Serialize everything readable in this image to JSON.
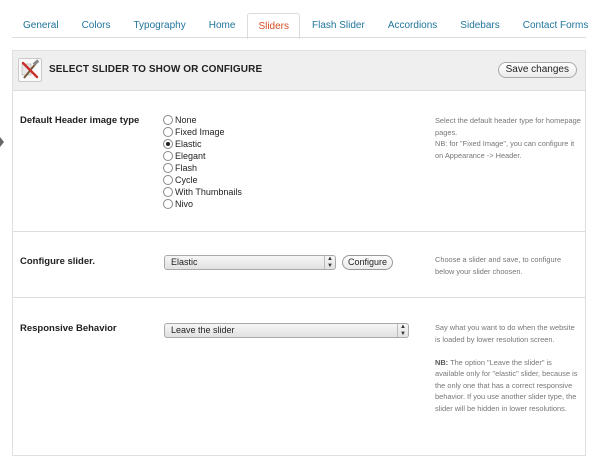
{
  "tabs": [
    "General",
    "Colors",
    "Typography",
    "Home",
    "Sliders",
    "Flash Slider",
    "Accordions",
    "Sidebars",
    "Contact Forms"
  ],
  "active_tab": "Sliders",
  "panel": {
    "title": "SELECT SLIDER TO SHOW OR CONFIGURE",
    "save_label": "Save changes"
  },
  "header_type": {
    "label": "Default Header image type",
    "options": [
      "None",
      "Fixed Image",
      "Elastic",
      "Elegant",
      "Flash",
      "Cycle",
      "With Thumbnails",
      "Nivo"
    ],
    "selected": "Elastic",
    "desc_1": "Select the default header type for homepage pages.",
    "desc_2": "NB: for \"Fixed Image\", you can configure it on Appearance -> Header."
  },
  "configure": {
    "label": "Configure slider.",
    "value": "Elastic",
    "button": "Configure",
    "desc": "Choose a slider and save, to configure below your slider choosen."
  },
  "responsive": {
    "label": "Responsive Behavior",
    "value": "Leave the slider",
    "desc_1": "Say what you want to do when the website is loaded by lower resolution screen.",
    "nb_prefix": "NB:",
    "desc_2": "The option \"Leave the slider\" is available only for \"elastic\" slider, because is the only one that has a correct responsive behavior. If you use another slider type, the slider will be hidden in lower resolutions."
  }
}
